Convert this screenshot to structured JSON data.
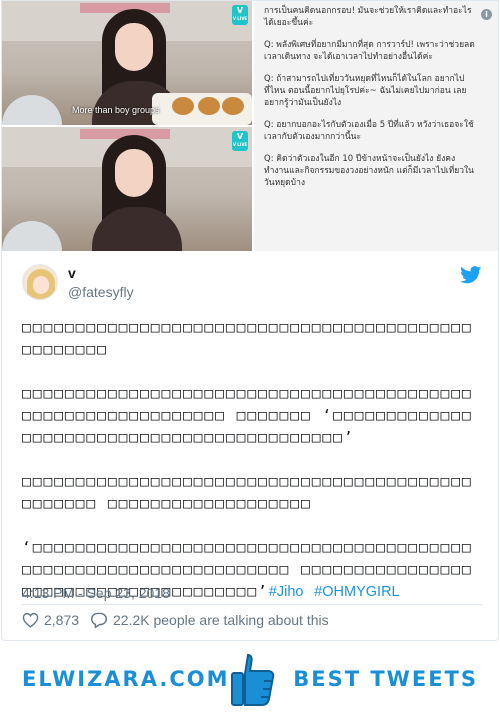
{
  "media": {
    "top_frame": {
      "badge_title": "V",
      "badge_sub": "V LIVE",
      "subtitle": "More than boy groups"
    },
    "bottom_frame": {
      "badge_title": "V",
      "badge_sub": "V LIVE"
    },
    "text_panel": {
      "paragraphs": [
        "การเป็นคนคิดนอกกรอบ! มันจะช่วยให้เราคิดและทำอะไรได้เยอะขึ้นค่ะ",
        "Q: พลังพิเศษที่อยากมีมากที่สุด การวาร์ป! เพราะว่าช่วยลดเวลาเดินทาง จะได้เอาเวลาไปทำอย่างอื่นได้ค่ะ",
        "Q: ถ้าสามารถไปเที่ยววันหยุดที่ไหนก็ได้ในโลก อยากไปที่ไหน ตอนนี้อยากไปยุโรปค่ะ~ ฉันไม่เคยไปมาก่อน เลยอยากรู้ว่ามันเป็นยังไง",
        "Q: อยากบอกอะไรกับตัวเองเมื่อ 5 ปีที่แล้ว หวังว่าเธอจะใช้เวลากับตัวเองมากกว่านี้นะ",
        "Q: คิดว่าตัวเองในอีก 10 ปีข้างหน้าจะเป็นยังไง ยังคงทำงานและกิจกรรมของวงอย่างหนัก แต่ก็มีเวลาไปเที่ยวในวันหยุดบ้าง"
      ],
      "info_glyph": "i"
    }
  },
  "author": {
    "display_name": "v",
    "screen_name": "@fatesyfly"
  },
  "tweet": {
    "paragraphs": [
      "□□□□□□□□□□□□□□□□□□□□□□□□□□□□□□□□□□□□□□□□□□□□□□□□□□",
      "□□□□□□□□□□□□□□□□□□□□□□□□□□□□□□□□□□□□□□□□□□□□□□□□□□□□□□□□□□□□□ □□□□□□□ ‘□□□□□□□□□□□□□□□□□□□□□□□□□□□□□□□□□□□□□□□□□□□’",
      "□□□□□□□□□□□□□□□□□□□□□□□□□□□□□□□□□□□□□□□□□□□□□□□□□ □□□□□□□□□□□□□□□□□□□"
    ],
    "last_paragraph_text": "‘□□□□□□□□□□□□□□□□□□□□□□□□□□□□□□□□□□□□□□□□□□□□□□□□□□□□□□□□□□□□□□□□□□ □□□□□□□□□□□□□□□□□□□□□□□□□□□□□□□□□□□□□□’",
    "hashtags": [
      "#Jiho",
      "#OHMYGIRL"
    ],
    "timestamp": "4:13 PM - Sep 23, 2018"
  },
  "stats": {
    "likes": "2,873",
    "replies_text": "22.2K people are talking about this"
  },
  "footer": {
    "brand": "ELWIZARA.COM",
    "tagline": "BEST TWEETS"
  },
  "colors": {
    "link": "#1b95e0",
    "muted": "#657786",
    "footer_blue": "#1b8fd6",
    "twitter_blue": "#1da1f2"
  },
  "icons": {
    "bird": "twitter-bird-icon",
    "heart": "heart-icon",
    "reply": "reply-bubble-icon",
    "info": "info-icon",
    "thumb": "thumbs-up-icon"
  }
}
